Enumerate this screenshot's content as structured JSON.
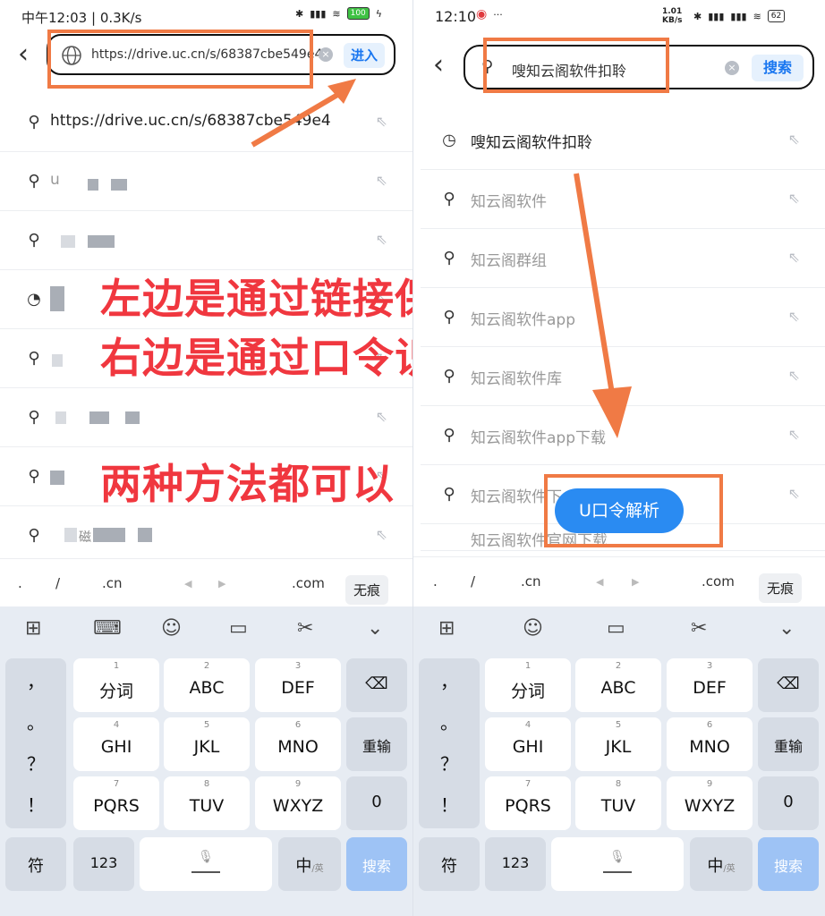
{
  "left": {
    "status_time": "中午12:03 | 0.3K/s",
    "battery": "100",
    "url_value": "https://drive.uc.cn/s/68387cbe549e4",
    "go_label": "进入",
    "suggestions": [
      {
        "text": "https://drive.uc.cn/s/68387cbe549e4"
      },
      {
        "text": "u"
      },
      {
        "text": ""
      },
      {
        "text": ""
      },
      {
        "text": ""
      },
      {
        "text": ""
      },
      {
        "text": ""
      },
      {
        "text": "磁"
      }
    ],
    "overlay_lines": [
      "左边是通过链接保存",
      "右边是通过口令识别",
      "两种方法都可以"
    ],
    "domain_keys": [
      ".",
      "/",
      ".cn",
      ".com"
    ],
    "no_trace": "无痕"
  },
  "right": {
    "status_time": "12:10",
    "net_speed": "1.01 KB/s",
    "battery": "62",
    "query_value": "嗖知云阁软件扣聆",
    "search_label": "搜索",
    "history_item": "嗖知云阁软件扣聆",
    "suggestions": [
      "知云阁软件",
      "知云阁群组",
      "知云阁软件app",
      "知云阁软件库",
      "知云阁软件app下载",
      "知云阁软件下",
      "知云阁软件官网下载"
    ],
    "parse_button": "U口令解析",
    "domain_keys": [
      ".",
      "/",
      ".cn",
      ".com"
    ],
    "no_trace": "无痕"
  },
  "keyboard": {
    "punctuation": [
      "，",
      "。",
      "？",
      "！"
    ],
    "rows": [
      [
        {
          "num": "1",
          "label": "分词"
        },
        {
          "num": "2",
          "label": "ABC"
        },
        {
          "num": "3",
          "label": "DEF"
        }
      ],
      [
        {
          "num": "4",
          "label": "GHI"
        },
        {
          "num": "5",
          "label": "JKL"
        },
        {
          "num": "6",
          "label": "MNO"
        }
      ],
      [
        {
          "num": "7",
          "label": "PQRS"
        },
        {
          "num": "8",
          "label": "TUV"
        },
        {
          "num": "9",
          "label": "WXYZ"
        }
      ]
    ],
    "reenter": "重输",
    "zero": "0",
    "symbols": "符",
    "num_mode": "123",
    "lang_main": "中",
    "lang_sub": "/英",
    "search": "搜索"
  },
  "colors": {
    "accent": "#f07a45",
    "overlay_red": "#f0373f",
    "blue": "#2a8bf2"
  }
}
